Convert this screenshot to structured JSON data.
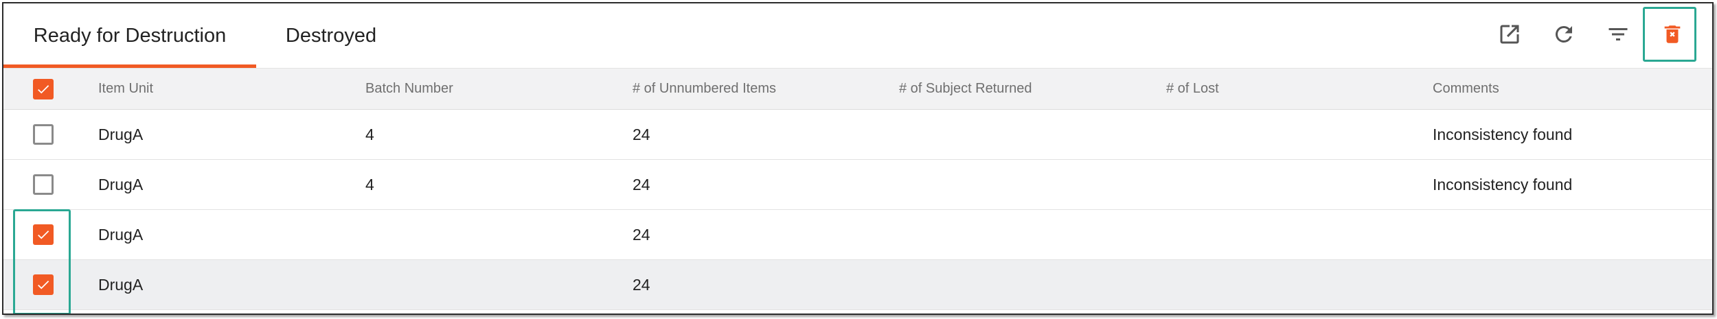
{
  "tabs": [
    {
      "label": "Ready for Destruction",
      "active": true
    },
    {
      "label": "Destroyed",
      "active": false
    }
  ],
  "toolbar": {
    "icons": [
      "export-icon",
      "refresh-icon",
      "filter-icon",
      "delete-icon"
    ]
  },
  "colors": {
    "accent": "#f15a24",
    "highlight": "#2aa893",
    "header_bg": "#f2f2f3",
    "row_hover_bg": "#eeeff1"
  },
  "table": {
    "header_checked": true,
    "columns": [
      "Item Unit",
      "Batch Number",
      "# of Unnumbered Items",
      "# of Subject Returned",
      "# of Lost",
      "Comments"
    ],
    "rows": [
      {
        "checked": false,
        "item_unit": "DrugA",
        "batch": "4",
        "unnumbered": "24",
        "subject_returned": "",
        "lost": "",
        "comments": "Inconsistency found"
      },
      {
        "checked": false,
        "item_unit": "DrugA",
        "batch": "4",
        "unnumbered": "24",
        "subject_returned": "",
        "lost": "",
        "comments": "Inconsistency found"
      },
      {
        "checked": true,
        "item_unit": "DrugA",
        "batch": "",
        "unnumbered": "24",
        "subject_returned": "",
        "lost": "",
        "comments": ""
      },
      {
        "checked": true,
        "item_unit": "DrugA",
        "batch": "",
        "unnumbered": "24",
        "subject_returned": "",
        "lost": "",
        "comments": ""
      }
    ]
  }
}
